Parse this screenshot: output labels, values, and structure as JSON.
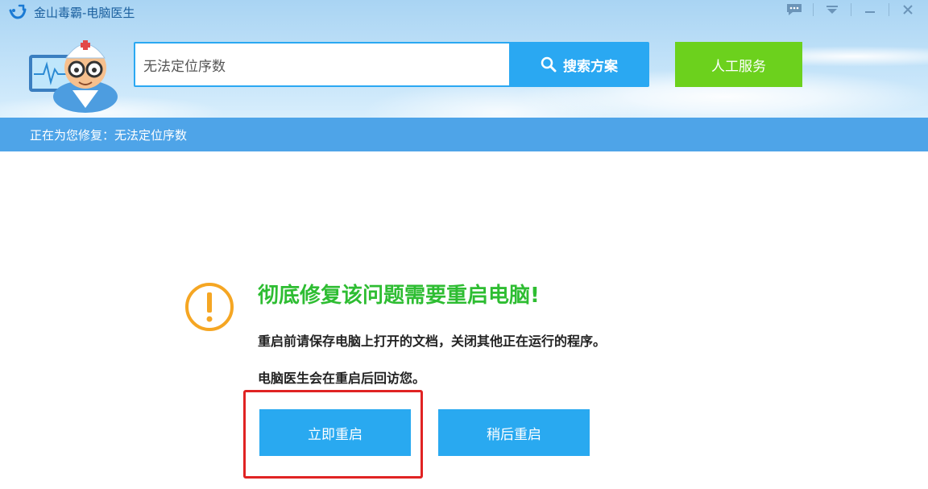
{
  "app": {
    "title": "金山毒霸-电脑医生"
  },
  "search": {
    "value": "无法定位序数",
    "button_label": "搜索方案"
  },
  "human_service": {
    "label": "人工服务"
  },
  "status": {
    "text": "正在为您修复：无法定位序数"
  },
  "notice": {
    "headline": "彻底修复该问题需要重启电脑!",
    "line1": "重启前请保存电脑上打开的文档，关闭其他正在运行的程序。",
    "line2": "电脑医生会在重启后回访您。"
  },
  "buttons": {
    "restart_now": "立即重启",
    "restart_later": "稍后重启"
  },
  "icons": [
    "app-logo-icon",
    "feedback-icon",
    "menu-icon",
    "minimize-icon",
    "close-icon",
    "search-icon",
    "warning-icon"
  ],
  "colors": {
    "accent_blue": "#29a9f0",
    "green": "#6cd11d",
    "headline_green": "#2ebd32",
    "warning_orange": "#f5a623",
    "highlight_red": "#e02323",
    "status_bar": "#4ea4e8"
  }
}
